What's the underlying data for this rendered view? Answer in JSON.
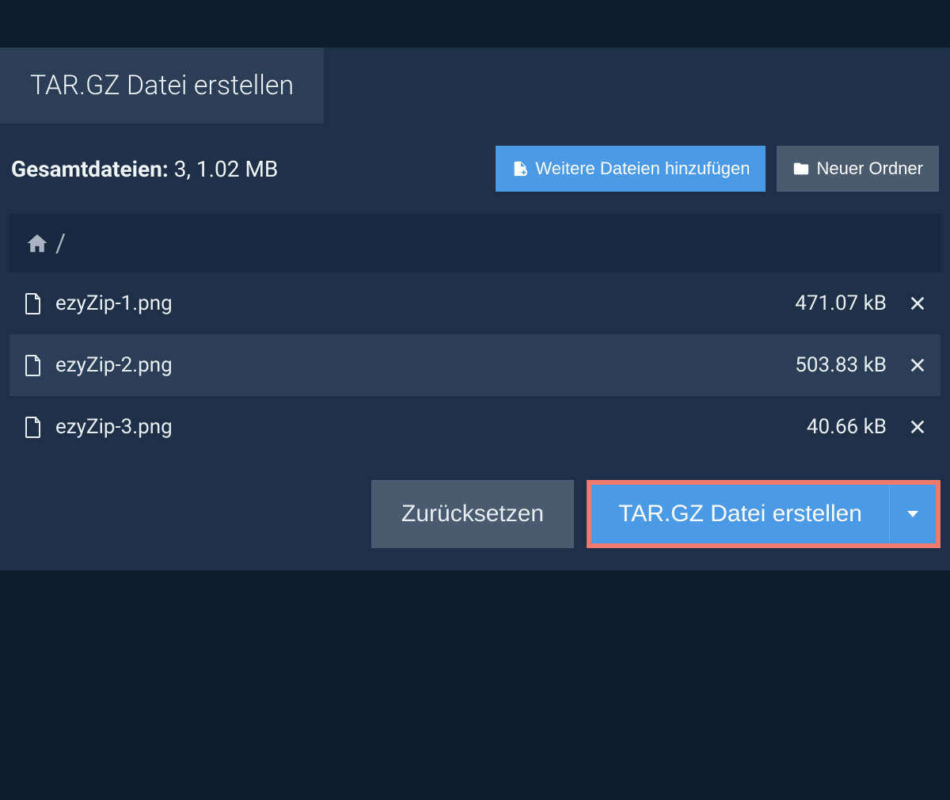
{
  "tab": {
    "title": "TAR.GZ Datei erstellen"
  },
  "summary": {
    "label": "Gesamtdateien:",
    "value": "3, 1.02 MB"
  },
  "toolbar": {
    "add_files_label": "Weitere Dateien hinzufügen",
    "new_folder_label": "Neuer Ordner"
  },
  "breadcrumb": {
    "path": "/"
  },
  "files": [
    {
      "name": "ezyZip-1.png",
      "size": "471.07 kB"
    },
    {
      "name": "ezyZip-2.png",
      "size": "503.83 kB"
    },
    {
      "name": "ezyZip-3.png",
      "size": "40.66 kB"
    }
  ],
  "footer": {
    "reset_label": "Zurücksetzen",
    "create_label": "TAR.GZ Datei erstellen"
  }
}
